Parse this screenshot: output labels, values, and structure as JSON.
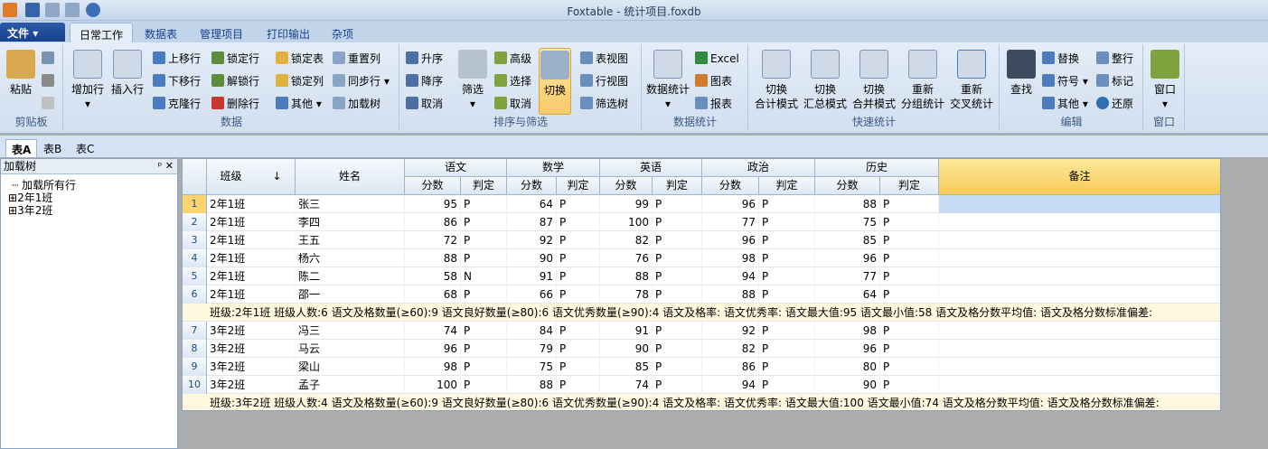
{
  "window": {
    "title": "Foxtable - 统计项目.foxdb"
  },
  "ribbon_tabs": [
    "文件",
    "日常工作",
    "数据表",
    "管理项目",
    "打印输出",
    "杂项"
  ],
  "groups": {
    "clipboard": {
      "label": "剪贴板",
      "paste": "粘贴"
    },
    "data": {
      "label": "数据",
      "add_row": "增加行",
      "insert_row": "插入行",
      "move_up": "上移行",
      "move_down": "下移行",
      "clone_row": "克隆行",
      "lock_row": "锁定行",
      "unlock_row": "解锁行",
      "delete_row": "删除行",
      "lock_table": "锁定表",
      "lock_col": "锁定列",
      "other": "其他",
      "reset_col": "重置列",
      "sync_row": "同步行",
      "load_tree": "加载树"
    },
    "sort_filter": {
      "label": "排序与筛选",
      "asc": "升序",
      "desc": "降序",
      "cancel": "取消",
      "filter": "筛选",
      "advanced": "高级",
      "select": "选择",
      "cancel2": "取消",
      "toggle": "切换",
      "table_view": "表视图",
      "row_view": "行视图",
      "filter_tree": "筛选树"
    },
    "stats": {
      "label": "数据统计",
      "data_stats": "数据统计",
      "excel": "Excel",
      "chart": "图表",
      "report": "报表"
    },
    "quick_stats": {
      "label": "快速统计",
      "b1": "切换\n合计模式",
      "b2": "切换\n汇总模式",
      "b3": "切换\n合并模式",
      "b4": "重新\n分组统计",
      "b5": "重新\n交叉统计"
    },
    "edit": {
      "label": "编辑",
      "find": "查找",
      "replace": "替换",
      "symbol": "符号",
      "other": "其他",
      "whole_row": "整行",
      "mark": "标记",
      "restore": "还原"
    },
    "window": {
      "label": "窗口",
      "window": "窗口"
    }
  },
  "doc_tabs": [
    "表A",
    "表B",
    "表C"
  ],
  "tree": {
    "title": "加载树",
    "pin": "ᵖ",
    "close": "✕",
    "nodes": [
      "加载所有行",
      "2年1班",
      "3年2班"
    ]
  },
  "grid": {
    "headers": {
      "class": "班级",
      "name": "姓名",
      "chinese": "语文",
      "math": "数学",
      "english": "英语",
      "politics": "政治",
      "history": "历史",
      "note": "备注",
      "score": "分数",
      "judge": "判定",
      "sort_arrow": "↓"
    },
    "rows": [
      {
        "n": "1",
        "cls": "2年1班",
        "name": "张三",
        "s": [
          "95",
          "P",
          "64",
          "P",
          "99",
          "P",
          "96",
          "P",
          "88",
          "P"
        ]
      },
      {
        "n": "2",
        "cls": "2年1班",
        "name": "李四",
        "s": [
          "86",
          "P",
          "87",
          "P",
          "100",
          "P",
          "77",
          "P",
          "75",
          "P"
        ]
      },
      {
        "n": "3",
        "cls": "2年1班",
        "name": "王五",
        "s": [
          "72",
          "P",
          "92",
          "P",
          "82",
          "P",
          "96",
          "P",
          "85",
          "P"
        ]
      },
      {
        "n": "4",
        "cls": "2年1班",
        "name": "杨六",
        "s": [
          "88",
          "P",
          "90",
          "P",
          "76",
          "P",
          "98",
          "P",
          "96",
          "P"
        ]
      },
      {
        "n": "5",
        "cls": "2年1班",
        "name": "陈二",
        "s": [
          "58",
          "N",
          "91",
          "P",
          "88",
          "P",
          "94",
          "P",
          "77",
          "P"
        ]
      },
      {
        "n": "6",
        "cls": "2年1班",
        "name": "邵一",
        "s": [
          "68",
          "P",
          "66",
          "P",
          "78",
          "P",
          "88",
          "P",
          "64",
          "P"
        ]
      },
      {
        "summary": "班级:2年1班  班级人数:6  语文及格数量(≥60):9  语文良好数量(≥80):6  语文优秀数量(≥90):4  语文及格率:  语文优秀率:  语文最大值:95  语文最小值:58  语文及格分数平均值:  语文及格分数标准偏差:"
      },
      {
        "n": "7",
        "cls": "3年2班",
        "name": "冯三",
        "s": [
          "74",
          "P",
          "84",
          "P",
          "91",
          "P",
          "92",
          "P",
          "98",
          "P"
        ]
      },
      {
        "n": "8",
        "cls": "3年2班",
        "name": "马云",
        "s": [
          "96",
          "P",
          "79",
          "P",
          "90",
          "P",
          "82",
          "P",
          "96",
          "P"
        ]
      },
      {
        "n": "9",
        "cls": "3年2班",
        "name": "梁山",
        "s": [
          "98",
          "P",
          "75",
          "P",
          "85",
          "P",
          "86",
          "P",
          "80",
          "P"
        ]
      },
      {
        "n": "10",
        "cls": "3年2班",
        "name": "孟子",
        "s": [
          "100",
          "P",
          "88",
          "P",
          "74",
          "P",
          "94",
          "P",
          "90",
          "P"
        ]
      },
      {
        "summary": "班级:3年2班  班级人数:4  语文及格数量(≥60):9  语文良好数量(≥80):6  语文优秀数量(≥90):4  语文及格率:  语文优秀率:  语文最大值:100  语文最小值:74  语文及格分数平均值:  语文及格分数标准偏差:"
      }
    ]
  }
}
